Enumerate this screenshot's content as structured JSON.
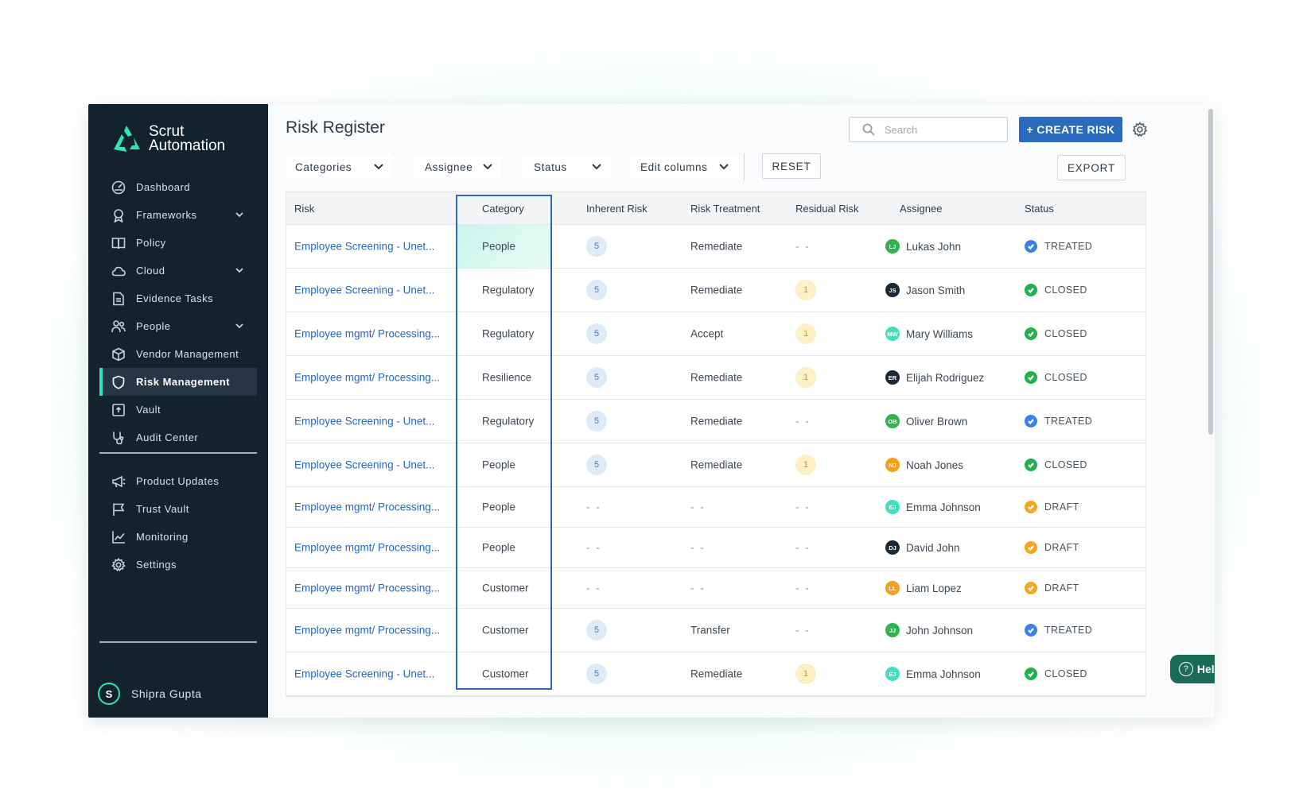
{
  "app": {
    "brand_line1": "Scrut",
    "brand_line2": "Automation",
    "accent": "#2ee6b8",
    "sidebar_bg": "#13222f"
  },
  "sidebar": {
    "items": [
      {
        "label": "Dashboard",
        "icon": "dashboard-icon",
        "chevron": false
      },
      {
        "label": "Frameworks",
        "icon": "award-icon",
        "chevron": true
      },
      {
        "label": "Policy",
        "icon": "book-icon",
        "chevron": false
      },
      {
        "label": "Cloud",
        "icon": "cloud-icon",
        "chevron": true
      },
      {
        "label": "Evidence Tasks",
        "icon": "document-icon",
        "chevron": false
      },
      {
        "label": "People",
        "icon": "people-icon",
        "chevron": true
      },
      {
        "label": "Vendor Management",
        "icon": "box-icon",
        "chevron": false
      },
      {
        "label": "Risk Management",
        "icon": "shield-icon",
        "chevron": false,
        "active": true
      },
      {
        "label": "Vault",
        "icon": "vault-icon",
        "chevron": false
      },
      {
        "label": "Audit Center",
        "icon": "stethoscope-icon",
        "chevron": false
      }
    ],
    "secondary": [
      {
        "label": "Product Updates",
        "icon": "megaphone-icon"
      },
      {
        "label": "Trust Vault",
        "icon": "flag-icon"
      },
      {
        "label": "Monitoring",
        "icon": "chart-icon"
      },
      {
        "label": "Settings",
        "icon": "gear-icon"
      }
    ],
    "user": {
      "initial": "S",
      "name": "Shipra Gupta"
    }
  },
  "header": {
    "title": "Risk Register",
    "search_placeholder": "Search",
    "create_label": "+ CREATE RISK"
  },
  "filters": {
    "categories": "Categories",
    "assignee": "Assignee",
    "status": "Status",
    "edit_columns": "Edit columns",
    "reset": "RESET",
    "export": "EXPORT"
  },
  "table": {
    "columns": [
      "Risk",
      "Category",
      "Inherent Risk",
      "Risk Treatment",
      "Residual Risk",
      "Assignee",
      "Status"
    ],
    "rows": [
      {
        "risk": "Employee Screening - Unet...",
        "category": "People",
        "inherent": "5",
        "treatment": "Remediate",
        "residual": "- -",
        "assignee": "Lukas John",
        "initials": "LJ",
        "av_color": "#2fb34f",
        "status": "TREATED",
        "status_color": "#3b82e6"
      },
      {
        "risk": "Employee Screening - Unet...",
        "category": "Regulatory",
        "inherent": "5",
        "treatment": "Remediate",
        "residual": "1",
        "assignee": "Jason Smith",
        "initials": "JS",
        "av_color": "#1b2836",
        "status": "CLOSED",
        "status_color": "#22b14c"
      },
      {
        "risk": "Employee mgmt/ Processing...",
        "category": "Regulatory",
        "inherent": "5",
        "treatment": "Accept",
        "residual": "1",
        "assignee": "Mary Williams",
        "initials": "MW",
        "av_color": "#3ee0c0",
        "status": "CLOSED",
        "status_color": "#22b14c"
      },
      {
        "risk": "Employee mgmt/ Processing...",
        "category": "Resilience",
        "inherent": "5",
        "treatment": "Remediate",
        "residual": "1",
        "assignee": "Elijah Rodriguez",
        "initials": "ER",
        "av_color": "#1b2836",
        "status": "CLOSED",
        "status_color": "#22b14c"
      },
      {
        "risk": "Employee Screening - Unet...",
        "category": "Regulatory",
        "inherent": "5",
        "treatment": "Remediate",
        "residual": "- -",
        "assignee": "Oliver Brown",
        "initials": "OB",
        "av_color": "#2fb34f",
        "status": "TREATED",
        "status_color": "#3b82e6"
      },
      {
        "risk": "Employee Screening - Unet...",
        "category": "People",
        "inherent": "5",
        "treatment": "Remediate",
        "residual": "1",
        "assignee": "Noah Jones",
        "initials": "NJ",
        "av_color": "#f59f1f",
        "status": "CLOSED",
        "status_color": "#22b14c"
      },
      {
        "risk": "Employee mgmt/ Processing...",
        "category": "People",
        "inherent": "- -",
        "treatment": "- -",
        "residual": "- -",
        "assignee": "Emma Johnson",
        "initials": "EJ",
        "av_color": "#3ee0c0",
        "status": "DRAFT",
        "status_color": "#f5a623"
      },
      {
        "risk": "Employee mgmt/ Processing...",
        "category": "People",
        "inherent": "- -",
        "treatment": "- -",
        "residual": "- -",
        "assignee": "David John",
        "initials": "DJ",
        "av_color": "#1b2836",
        "status": "DRAFT",
        "status_color": "#f5a623"
      },
      {
        "risk": "Employee mgmt/ Processing...",
        "category": "Customer",
        "inherent": "- -",
        "treatment": "- -",
        "residual": "- -",
        "assignee": "Liam Lopez",
        "initials": "LL",
        "av_color": "#f59f1f",
        "status": "DRAFT",
        "status_color": "#f5a623"
      },
      {
        "risk": "Employee mgmt/ Processing...",
        "category": "Customer",
        "inherent": "5",
        "treatment": "Transfer",
        "residual": "- -",
        "assignee": "John Johnson",
        "initials": "JJ",
        "av_color": "#2fb34f",
        "status": "TREATED",
        "status_color": "#3b82e6"
      },
      {
        "risk": "Employee Screening - Unet...",
        "category": "Customer",
        "inherent": "5",
        "treatment": "Remediate",
        "residual": "1",
        "assignee": "Emma Johnson",
        "initials": "EJ",
        "av_color": "#3ee0c0",
        "status": "CLOSED",
        "status_color": "#22b14c"
      }
    ]
  },
  "help": {
    "label": "Help"
  }
}
